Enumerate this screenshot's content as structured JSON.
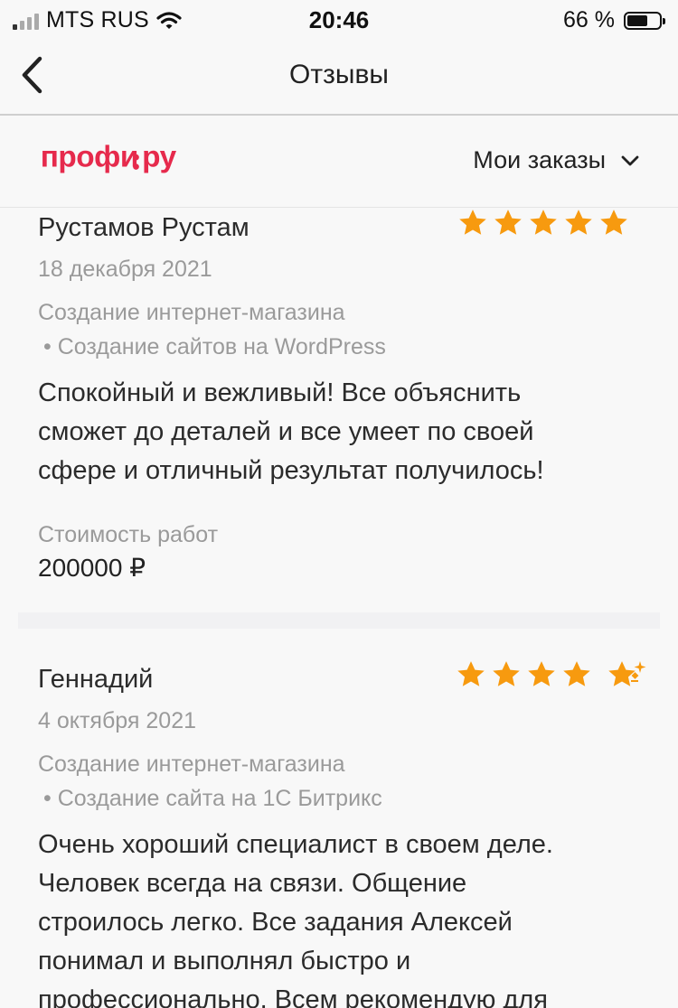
{
  "status_bar": {
    "carrier": "MTS RUS",
    "time": "20:46",
    "battery": "66 %",
    "battery_level": 0.66
  },
  "nav": {
    "title": "Отзывы"
  },
  "header": {
    "logo_text": "профи.ру",
    "orders_label": "Мои заказы"
  },
  "reviews": [
    {
      "name": "Рустамов Рустам",
      "date": "18 декабря 2021",
      "category": "Создание интернет-магазина",
      "subcategory": "• Создание сайтов на WordPress",
      "text_lines": [
        "Спокойный и вежливый! Все объяснить",
        "сможет до деталей и все умеет по своей",
        "сфере и отличный результат получилось!"
      ],
      "cost_label": "Стоимость работ",
      "cost": "200000 ₽",
      "rating": 5
    },
    {
      "name": "Геннадий",
      "date": "4 октября 2021",
      "category": "Создание интернет-магазина",
      "subcategory": "• Создание сайта на 1С Битрикс",
      "text_lines": [
        "Очень хороший специалист в своем деле.",
        "Человек всегда на связи. Общение",
        "строилось легко. Все задания Алексей",
        "понимал и выполнял быстро и",
        "профессионально. Всем рекомендую для"
      ],
      "rating": 5,
      "rating_badge": "sparkle"
    }
  ],
  "colors": {
    "brand": "#e62a4c",
    "star": "#f79a0f",
    "muted": "#9a9a9a",
    "text": "#2b2b2b"
  }
}
